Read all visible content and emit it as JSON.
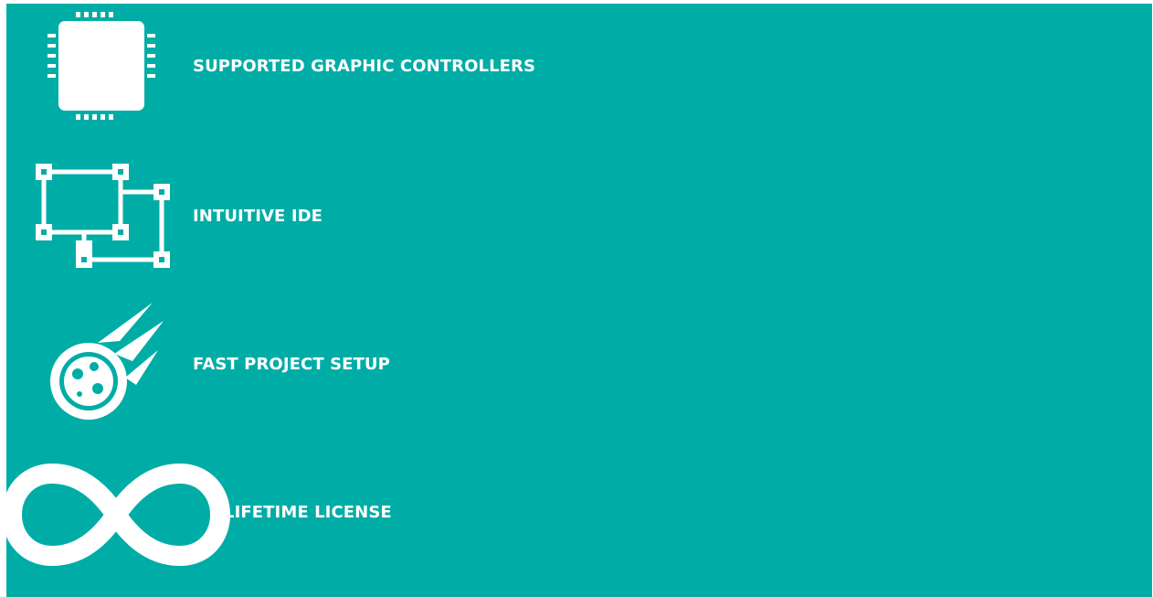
{
  "colors": {
    "background": "#00ada6",
    "foreground": "#ffffff"
  },
  "features": [
    {
      "label": "SUPPORTED GRAPHIC CONTROLLERS",
      "icon": "chip-icon"
    },
    {
      "label": "INTUITIVE IDE",
      "icon": "node-diagram-icon"
    },
    {
      "label": "FAST PROJECT SETUP",
      "icon": "comet-icon"
    },
    {
      "label": "LIFETIME LICENSE",
      "icon": "infinity-icon"
    }
  ]
}
